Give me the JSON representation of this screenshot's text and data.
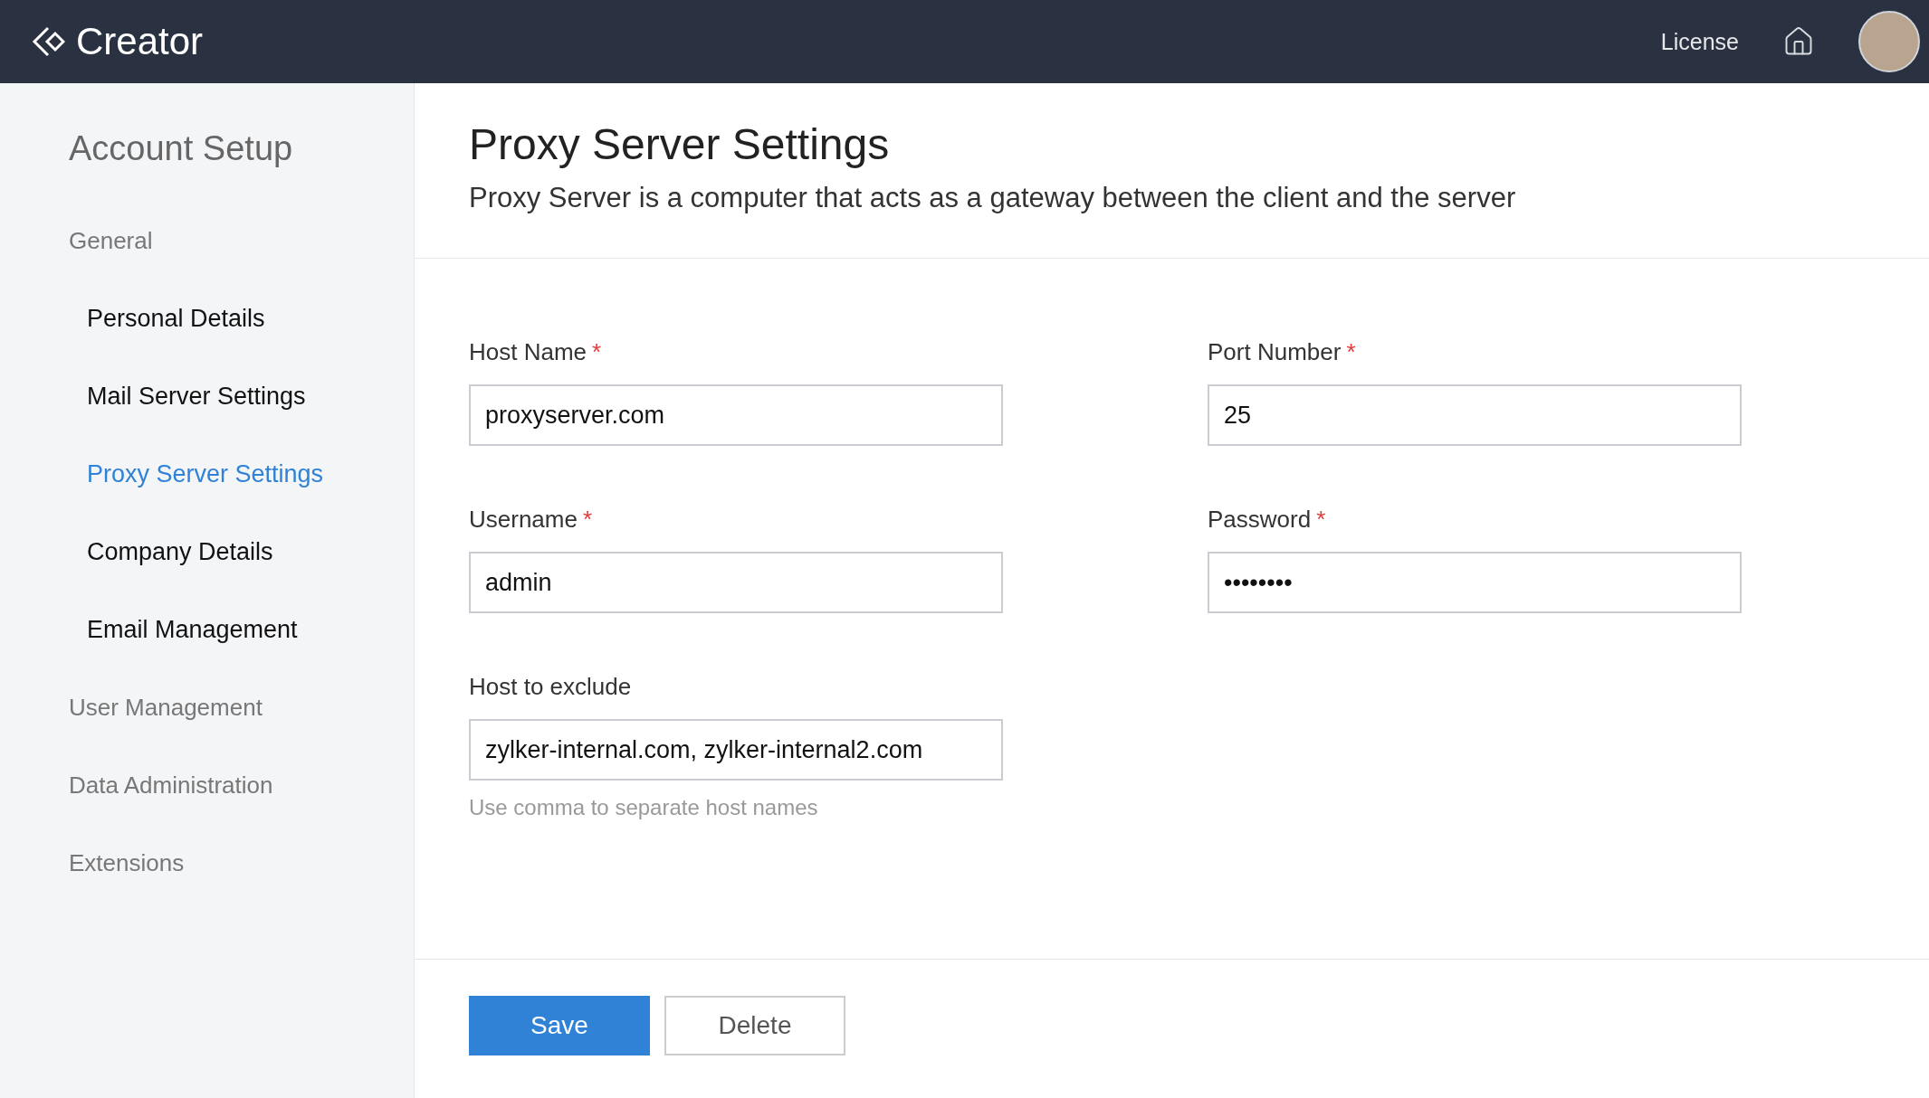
{
  "header": {
    "brand": "Creator",
    "links": [
      {
        "label": "License"
      }
    ]
  },
  "sidebar": {
    "title": "Account Setup",
    "groups": [
      {
        "label": "General",
        "children": [
          {
            "label": "Personal Details",
            "selected": false
          },
          {
            "label": "Mail Server Settings",
            "selected": false
          },
          {
            "label": "Proxy Server Settings",
            "selected": true
          },
          {
            "label": "Company Details",
            "selected": false
          },
          {
            "label": "Email Management",
            "selected": false
          }
        ]
      },
      {
        "label": "User Management"
      },
      {
        "label": "Data Administration"
      },
      {
        "label": "Extensions"
      }
    ]
  },
  "page": {
    "title": "Proxy Server Settings",
    "description": "Proxy Server is a computer that acts as a gateway between the client and the server"
  },
  "form": {
    "fields": [
      {
        "label": "Host Name",
        "required_mark": "*",
        "value": "proxyserver.com"
      },
      {
        "label": "Port Number",
        "required_mark": "*",
        "value": "25"
      },
      {
        "label": "Username",
        "required_mark": "*",
        "value": "admin"
      },
      {
        "label": "Password",
        "required_mark": "*",
        "value": "••••••••"
      },
      {
        "label": "Host to exclude",
        "value": "zylker-internal.com, zylker-internal2.com",
        "hint": "Use comma to separate host names"
      }
    ]
  },
  "buttons": [
    {
      "label": "Save",
      "kind": "primary"
    },
    {
      "label": "Delete",
      "kind": "secondary"
    }
  ]
}
